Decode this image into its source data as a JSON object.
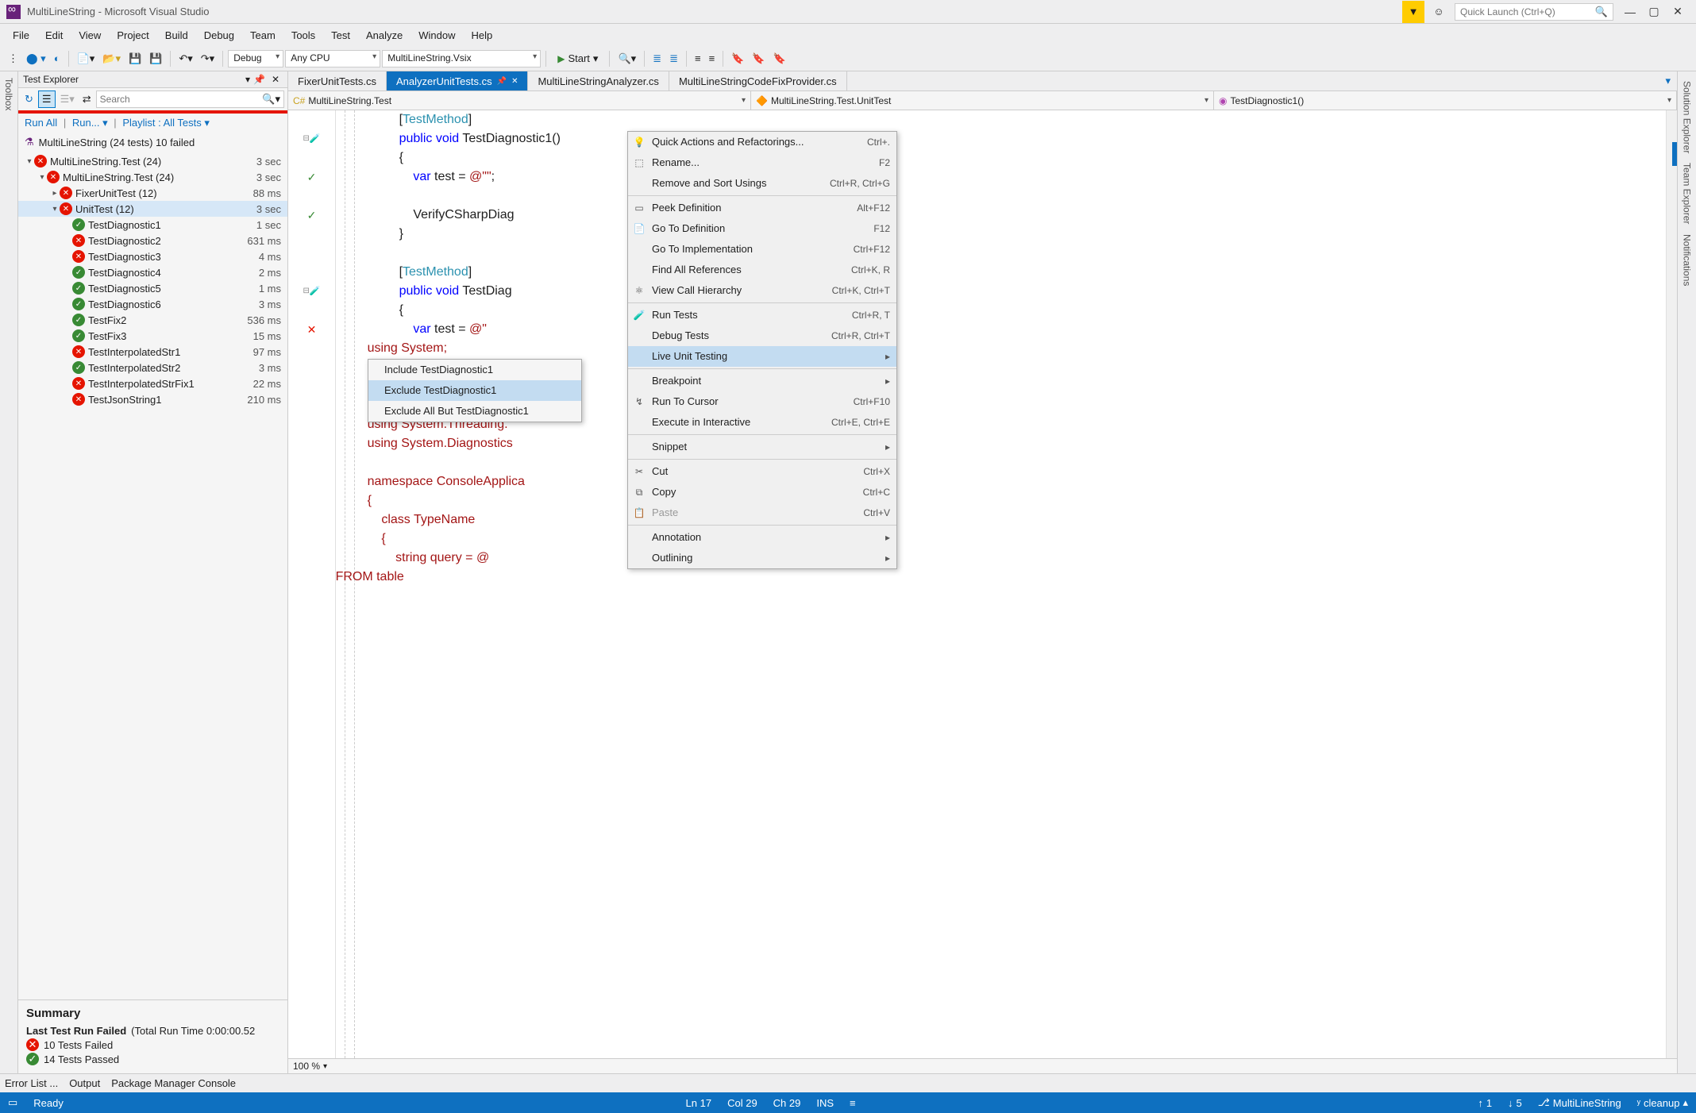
{
  "titlebar": {
    "title": "MultiLineString - Microsoft Visual Studio",
    "quick_launch_placeholder": "Quick Launch (Ctrl+Q)"
  },
  "menubar": [
    "File",
    "Edit",
    "View",
    "Project",
    "Build",
    "Debug",
    "Team",
    "Tools",
    "Test",
    "Analyze",
    "Window",
    "Help"
  ],
  "toolbar": {
    "config": "Debug",
    "platform": "Any CPU",
    "startup": "MultiLineString.Vsix",
    "start": "Start"
  },
  "left_tool_tab": "Toolbox",
  "test_explorer": {
    "title": "Test Explorer",
    "search_placeholder": "Search",
    "links_run_all": "Run All",
    "links_run": "Run...",
    "links_playlist": "Playlist : All Tests",
    "summary_title": "MultiLineString (24 tests) 10 failed",
    "tree": [
      {
        "depth": 0,
        "exp": "▾",
        "status": "fail",
        "name": "MultiLineString.Test (24)",
        "time": "3 sec"
      },
      {
        "depth": 1,
        "exp": "▾",
        "status": "fail",
        "name": "MultiLineString.Test (24)",
        "time": "3 sec"
      },
      {
        "depth": 2,
        "exp": "▸",
        "status": "fail",
        "name": "FixerUnitTest (12)",
        "time": "88 ms"
      },
      {
        "depth": 2,
        "exp": "▾",
        "status": "fail",
        "name": "UnitTest (12)",
        "time": "3 sec",
        "selected": true
      },
      {
        "depth": 3,
        "exp": "",
        "status": "pass",
        "name": "TestDiagnostic1",
        "time": "1 sec"
      },
      {
        "depth": 3,
        "exp": "",
        "status": "fail",
        "name": "TestDiagnostic2",
        "time": "631 ms"
      },
      {
        "depth": 3,
        "exp": "",
        "status": "fail",
        "name": "TestDiagnostic3",
        "time": "4 ms"
      },
      {
        "depth": 3,
        "exp": "",
        "status": "pass",
        "name": "TestDiagnostic4",
        "time": "2 ms"
      },
      {
        "depth": 3,
        "exp": "",
        "status": "pass",
        "name": "TestDiagnostic5",
        "time": "1 ms"
      },
      {
        "depth": 3,
        "exp": "",
        "status": "pass",
        "name": "TestDiagnostic6",
        "time": "3 ms"
      },
      {
        "depth": 3,
        "exp": "",
        "status": "pass",
        "name": "TestFix2",
        "time": "536 ms"
      },
      {
        "depth": 3,
        "exp": "",
        "status": "pass",
        "name": "TestFix3",
        "time": "15 ms"
      },
      {
        "depth": 3,
        "exp": "",
        "status": "fail",
        "name": "TestInterpolatedStr1",
        "time": "97 ms"
      },
      {
        "depth": 3,
        "exp": "",
        "status": "pass",
        "name": "TestInterpolatedStr2",
        "time": "3 ms"
      },
      {
        "depth": 3,
        "exp": "",
        "status": "fail",
        "name": "TestInterpolatedStrFix1",
        "time": "22 ms"
      },
      {
        "depth": 3,
        "exp": "",
        "status": "fail",
        "name": "TestJsonString1",
        "time": "210 ms"
      }
    ],
    "footer": {
      "heading": "Summary",
      "last_run": "Last Test Run Failed",
      "last_run_detail": "(Total Run Time 0:00:00.52",
      "failed_line": "10 Tests Failed",
      "passed_line": "14 Tests Passed"
    }
  },
  "doc_tabs": [
    {
      "label": "FixerUnitTests.cs",
      "active": false
    },
    {
      "label": "AnalyzerUnitTests.cs",
      "active": true
    },
    {
      "label": "MultiLineStringAnalyzer.cs",
      "active": false
    },
    {
      "label": "MultiLineStringCodeFixProvider.cs",
      "active": false
    }
  ],
  "nav": {
    "ns": "MultiLineString.Test",
    "class": "MultiLineString.Test.UnitTest",
    "member": "TestDiagnostic1()"
  },
  "zoom": "100 %",
  "code_lines": [
    {
      "gut": "",
      "html": "[<span class='kw-attr'>TestMethod</span>]"
    },
    {
      "gut": "fold",
      "flask": "pass",
      "html": "<span class='kw-blue'>public</span> <span class='kw-blue'>void</span> TestDiagnostic1()"
    },
    {
      "gut": "",
      "html": "{"
    },
    {
      "gut": "pass",
      "html": "    <span class='kw-blue'>var</span> test = <span class='kw-str'>@\"\"</span>;"
    },
    {
      "gut": "",
      "html": ""
    },
    {
      "gut": "pass",
      "html": "    VerifyCSharpDiag"
    },
    {
      "gut": "",
      "html": "}"
    },
    {
      "gut": "",
      "html": ""
    },
    {
      "gut": "",
      "html": "[<span class='kw-attr'>TestMethod</span>]"
    },
    {
      "gut": "fold",
      "flask": "fail",
      "html": "<span class='kw-blue'>public</span> <span class='kw-blue'>void</span> TestDiag"
    },
    {
      "gut": "",
      "html": "{"
    },
    {
      "gut": "fail",
      "html": "    <span class='kw-blue'>var</span> test = <span class='kw-str'>@\"</span>"
    },
    {
      "gut": "",
      "html": "<span class='kw-str' style='margin-left:-40px'>using System;</span>"
    },
    {
      "gut": "",
      "html": ""
    },
    {
      "gut": "",
      "html": ""
    },
    {
      "gut": "",
      "html": ""
    },
    {
      "gut": "",
      "html": "<span class='kw-str' style='margin-left:-40px'>using System.Threading.</span>"
    },
    {
      "gut": "",
      "html": "<span class='kw-str' style='margin-left:-40px'>using System.Diagnostics</span>"
    },
    {
      "gut": "",
      "html": ""
    },
    {
      "gut": "",
      "html": "<span class='kw-str' style='margin-left:-40px'>namespace ConsoleApplica</span>"
    },
    {
      "gut": "",
      "html": "<span class='kw-str' style='margin-left:-40px'>{</span>"
    },
    {
      "gut": "",
      "html": "<span class='kw-str' style='margin-left:-40px'>    class TypeName</span>"
    },
    {
      "gut": "",
      "html": "<span class='kw-str' style='margin-left:-40px'>    {</span>"
    },
    {
      "gut": "",
      "html": "<span class='kw-str' style='margin-left:-40px'>        string query = @</span>"
    },
    {
      "gut": "",
      "html": "<span class='kw-str' style='margin-left:-80px'>FROM table</span>"
    }
  ],
  "context_menu": {
    "items": [
      {
        "icon": "💡",
        "label": "Quick Actions and Refactorings...",
        "key": "Ctrl+."
      },
      {
        "icon": "⬚",
        "label": "Rename...",
        "key": "F2"
      },
      {
        "label": "Remove and Sort Usings",
        "key": "Ctrl+R, Ctrl+G"
      },
      {
        "sep": true
      },
      {
        "icon": "▭",
        "label": "Peek Definition",
        "key": "Alt+F12"
      },
      {
        "icon": "📄",
        "label": "Go To Definition",
        "key": "F12"
      },
      {
        "label": "Go To Implementation",
        "key": "Ctrl+F12"
      },
      {
        "label": "Find All References",
        "key": "Ctrl+K, R"
      },
      {
        "icon": "⚛",
        "label": "View Call Hierarchy",
        "key": "Ctrl+K, Ctrl+T"
      },
      {
        "sep": true
      },
      {
        "icon": "🧪",
        "label": "Run Tests",
        "key": "Ctrl+R, T"
      },
      {
        "label": "Debug Tests",
        "key": "Ctrl+R, Ctrl+T"
      },
      {
        "label": "Live Unit Testing",
        "arrow": true,
        "highlighted": true
      },
      {
        "sep": true
      },
      {
        "label": "Breakpoint",
        "arrow": true
      },
      {
        "icon": "↯",
        "label": "Run To Cursor",
        "key": "Ctrl+F10"
      },
      {
        "label": "Execute in Interactive",
        "key": "Ctrl+E, Ctrl+E"
      },
      {
        "sep": true
      },
      {
        "label": "Snippet",
        "arrow": true
      },
      {
        "sep": true
      },
      {
        "icon": "✂",
        "label": "Cut",
        "key": "Ctrl+X"
      },
      {
        "icon": "⧉",
        "label": "Copy",
        "key": "Ctrl+C"
      },
      {
        "icon": "📋",
        "label": "Paste",
        "key": "Ctrl+V",
        "disabled": true
      },
      {
        "sep": true
      },
      {
        "label": "Annotation",
        "arrow": true
      },
      {
        "label": "Outlining",
        "arrow": true
      }
    ]
  },
  "submenu": {
    "items": [
      {
        "label": "Include TestDiagnostic1"
      },
      {
        "label": "Exclude TestDiagnostic1",
        "highlighted": true
      },
      {
        "label": "Exclude All But TestDiagnostic1"
      }
    ]
  },
  "right_tabs": [
    "Solution Explorer",
    "Team Explorer",
    "Notifications"
  ],
  "bottom_tabs": [
    "Error List ...",
    "Output",
    "Package Manager Console"
  ],
  "statusbar": {
    "ready": "Ready",
    "ln": "Ln 17",
    "col": "Col 29",
    "ch": "Ch 29",
    "ins": "INS",
    "up": "1",
    "down": "5",
    "repo": "MultiLineString",
    "branch": "cleanup"
  }
}
